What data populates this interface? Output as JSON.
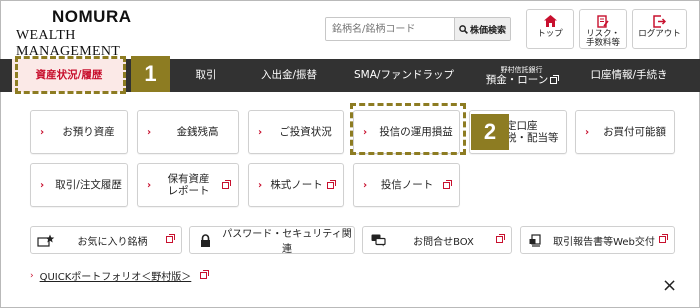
{
  "brand": {
    "line1": "NOMURA",
    "line2": "WEALTH MANAGEMENT"
  },
  "search": {
    "placeholder": "銘柄名/銘柄コード",
    "button": "株価検索"
  },
  "header_buttons": [
    {
      "label": "トップ"
    },
    {
      "label": "リスク・\n手数料等"
    },
    {
      "label": "ログアウト"
    }
  ],
  "nav": {
    "items": [
      {
        "label": "資産状況/履歴"
      },
      {
        "label": "取引"
      },
      {
        "label": "入出金/振替"
      },
      {
        "label": "SMA/ファンドラップ"
      },
      {
        "label_top": "野村信託銀行",
        "label": "預金・ローン"
      },
      {
        "label": "口座情報/手続き"
      }
    ],
    "partial_hidden": "報"
  },
  "callouts": {
    "one": "1",
    "two": "2"
  },
  "menu": [
    {
      "label": "お預り資産"
    },
    {
      "label": "金銭残高"
    },
    {
      "label": "ご投資状況"
    },
    {
      "label": "投信の運用損益"
    },
    {
      "label": "定口座\n税・配当等"
    },
    {
      "label": "お買付可能額"
    },
    {
      "label": "取引/注文履歴"
    },
    {
      "label": "保有資産\nレポート"
    },
    {
      "label": "株式ノート"
    },
    {
      "label": "投信ノート"
    }
  ],
  "utility": [
    {
      "label": "お気に入り銘柄",
      "icon": "favorite-star-icon"
    },
    {
      "label": "パスワード・セキュリティ関連",
      "icon": "lock-icon"
    },
    {
      "label": "お問合せBOX",
      "icon": "chat-icon"
    },
    {
      "label": "取引報告書等Web交付",
      "icon": "document-icon"
    }
  ],
  "quick_link": "QUICKポートフォリオ＜野村版＞",
  "close": "×",
  "colors": {
    "nav_bg": "#323232",
    "accent": "#c8102e",
    "callout": "#8d7c22"
  }
}
